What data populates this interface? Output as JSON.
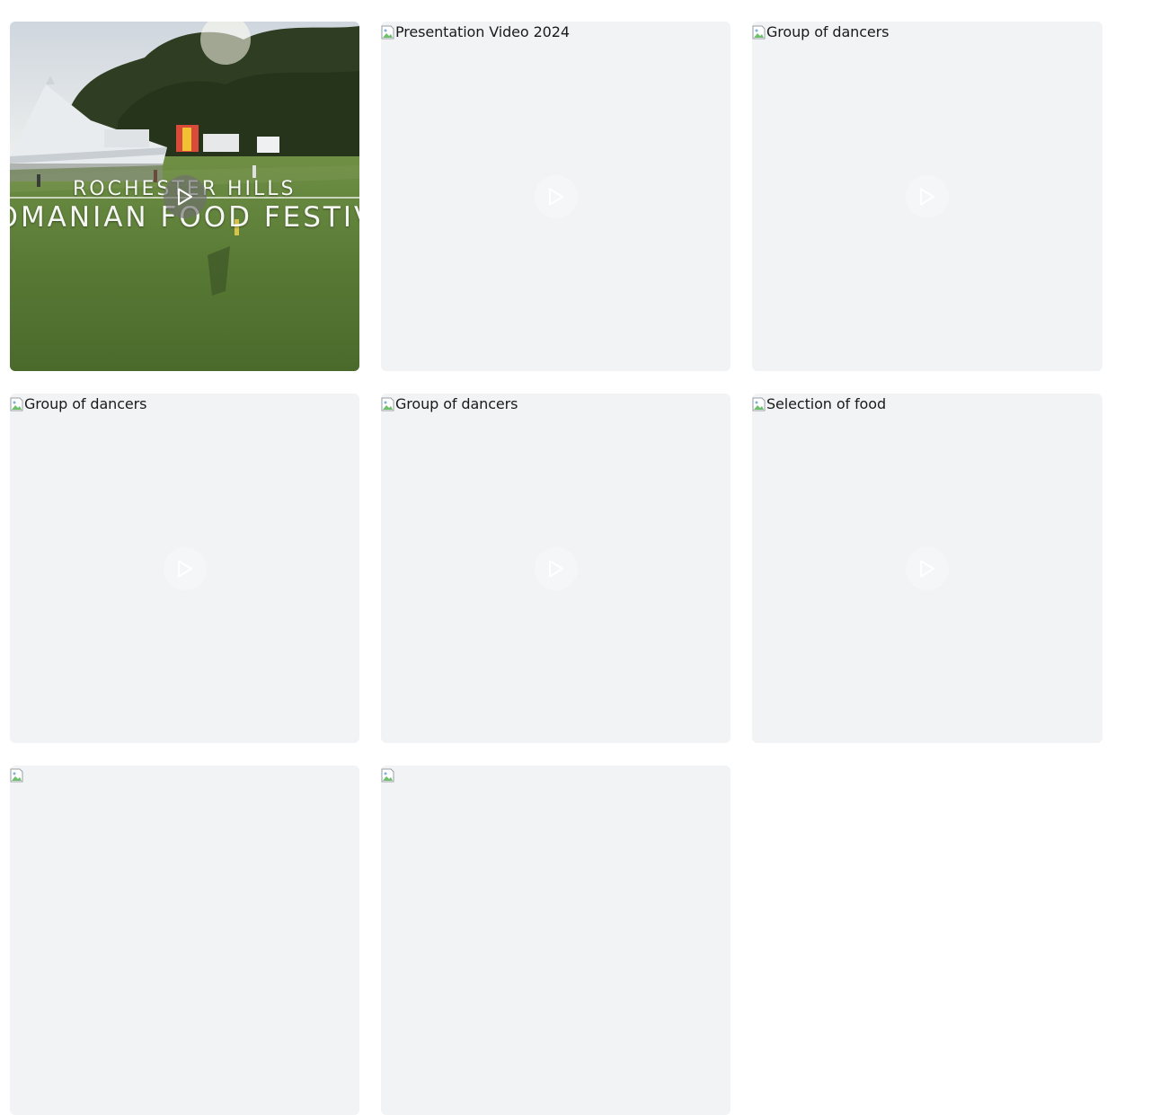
{
  "gallery": {
    "items": [
      {
        "kind": "video-poster",
        "overlay_line1": "ROCHESTER HILLS",
        "overlay_line2": "ROMANIAN FOOD FESTIVAL"
      },
      {
        "kind": "broken-image",
        "alt": "Presentation Video 2024"
      },
      {
        "kind": "broken-image",
        "alt": "Group of dancers"
      },
      {
        "kind": "broken-image",
        "alt": "Group of dancers"
      },
      {
        "kind": "broken-image",
        "alt": "Group of dancers"
      },
      {
        "kind": "broken-image",
        "alt": "Selection of food"
      },
      {
        "kind": "broken-image",
        "alt": ""
      },
      {
        "kind": "broken-image",
        "alt": ""
      }
    ]
  },
  "colors": {
    "tile_bg": "#f2f3f5",
    "play_idle": "#ffffff",
    "grass": "#5c7a3a",
    "tent": "#e9ecef"
  },
  "icons": {
    "play": "play-icon",
    "broken_image": "broken-image-icon"
  }
}
